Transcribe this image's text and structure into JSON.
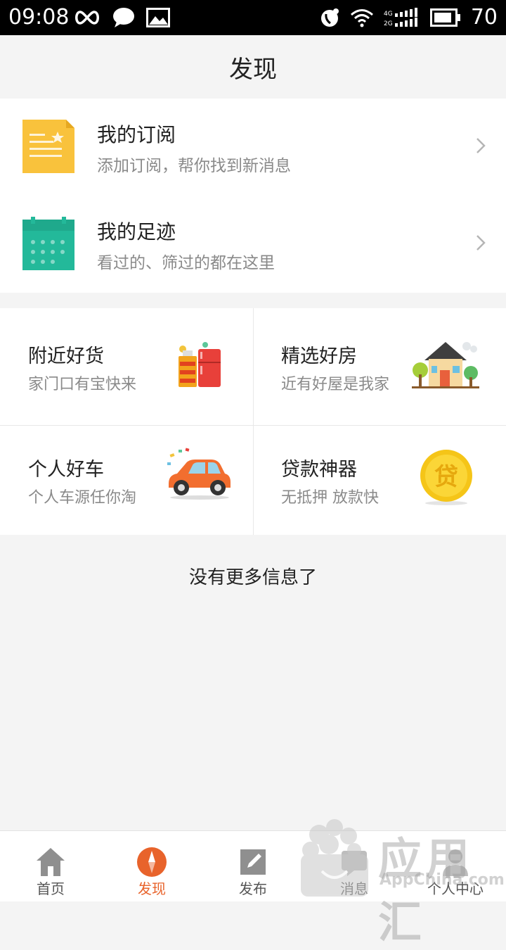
{
  "status_bar": {
    "time": "09:08",
    "battery": "70",
    "icons": [
      "infinity-icon",
      "chat-bubble-icon",
      "image-icon",
      "phone-icon",
      "wifi-icon",
      "signal-icon",
      "battery-icon"
    ]
  },
  "header": {
    "title": "发现"
  },
  "list": {
    "items": [
      {
        "title": "我的订阅",
        "subtitle": "添加订阅，帮你找到新消息",
        "icon": "document-star-icon",
        "color": "#F9C23C"
      },
      {
        "title": "我的足迹",
        "subtitle": "看过的、筛过的都在这里",
        "icon": "calendar-icon",
        "color": "#23B99A"
      }
    ]
  },
  "grid": {
    "cells": [
      {
        "title": "附近好货",
        "subtitle": "家门口有宝快来",
        "icon": "appliances-icon"
      },
      {
        "title": "精选好房",
        "subtitle": "近有好屋是我家",
        "icon": "house-icon"
      },
      {
        "title": "个人好车",
        "subtitle": "个人车源任你淘",
        "icon": "car-icon"
      },
      {
        "title": "贷款神器",
        "subtitle": "无抵押 放款快",
        "icon": "coin-icon",
        "coin_text": "贷"
      }
    ]
  },
  "footer_text": "没有更多信息了",
  "bottom_nav": {
    "active": 1,
    "active_color": "#E8632B",
    "items": [
      {
        "label": "首页",
        "icon": "home-icon"
      },
      {
        "label": "发现",
        "icon": "compass-icon"
      },
      {
        "label": "发布",
        "icon": "edit-icon"
      },
      {
        "label": "消息",
        "icon": "message-icon"
      },
      {
        "label": "个人中心",
        "icon": "person-icon"
      }
    ]
  },
  "watermark": {
    "text": "应用汇",
    "sub": "AppChina.com"
  }
}
